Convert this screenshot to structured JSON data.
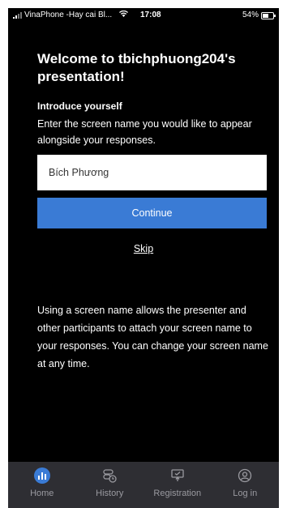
{
  "status_bar": {
    "carrier": "VinaPhone -Hay cai Bl...",
    "time": "17:08",
    "battery": "54%"
  },
  "page": {
    "title": "Welcome to tbichphuong204's presentation!",
    "intro_heading": "Introduce yourself",
    "intro_text": "Enter the screen name you would like to appear alongside your responses.",
    "name_field_value": "Bích Phương",
    "continue_label": "Continue",
    "skip_label": "Skip",
    "info_text": "Using a screen name allows the presenter and other participants to attach your screen name to your responses. You can change your screen name at any time."
  },
  "tabbar": {
    "items": [
      {
        "label": "Home",
        "icon": "home-chart-icon",
        "active": true
      },
      {
        "label": "History",
        "icon": "history-icon",
        "active": false
      },
      {
        "label": "Registration",
        "icon": "registration-icon",
        "active": false
      },
      {
        "label": "Log in",
        "icon": "user-icon",
        "active": false
      }
    ]
  },
  "colors": {
    "accent": "#3a7bd5",
    "background": "#000000",
    "tabbar": "#2e2e33"
  }
}
